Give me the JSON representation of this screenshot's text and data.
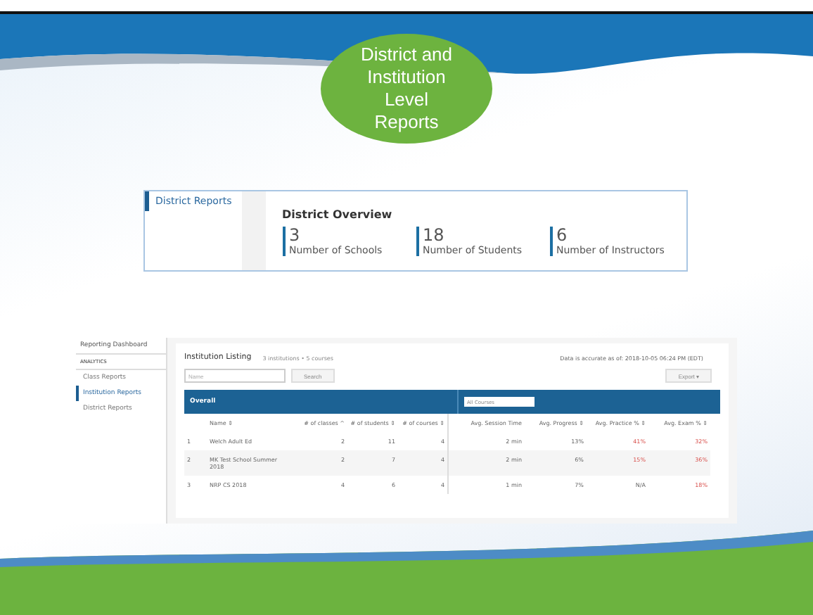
{
  "slide": {
    "title": "District and Institution Level Reports"
  },
  "district_panel": {
    "sidebar": [
      {
        "label": "District Reports",
        "selected": true
      }
    ],
    "title": "District Overview",
    "stats": [
      {
        "value": "3",
        "label": "Number of Schools"
      },
      {
        "value": "18",
        "label": "Number of Students"
      },
      {
        "value": "6",
        "label": "Number of Instructors"
      }
    ]
  },
  "institution_panel": {
    "sidebar": {
      "title": "Reporting Dashboard",
      "section": "ANALYTICS",
      "items": [
        {
          "label": "Class Reports",
          "selected": false
        },
        {
          "label": "Institution Reports",
          "selected": true
        },
        {
          "label": "District Reports",
          "selected": false
        }
      ]
    },
    "title": "Institution Listing",
    "summary": "3 institutions • 5 courses",
    "accuracy": "Data is accurate as of: 2018-10-05 06:24 PM (EDT)",
    "search": {
      "placeholder": "Name",
      "button": "Search"
    },
    "export": "Export ▾",
    "band": {
      "label": "Overall",
      "select": "All Courses"
    },
    "columns": [
      "Name ⇕",
      "# of classes ^",
      "# of students ⇕",
      "# of courses ⇕",
      "Avg. Session Time",
      "Avg. Progress ⇕",
      "Avg. Practice % ⇕",
      "Avg. Exam % ⇕"
    ],
    "rows": [
      {
        "number": "1",
        "cells": [
          {
            "text": "Welch Adult Ed",
            "alert": false
          },
          {
            "text": "2",
            "alert": false
          },
          {
            "text": "11",
            "alert": false
          },
          {
            "text": "4",
            "alert": false
          },
          {
            "text": "2 min",
            "alert": false
          },
          {
            "text": "13%",
            "alert": false
          },
          {
            "text": "41%",
            "alert": true
          },
          {
            "text": "32%",
            "alert": true
          }
        ]
      },
      {
        "number": "2",
        "cells": [
          {
            "text": "MK Test School Summer 2018",
            "alert": false
          },
          {
            "text": "2",
            "alert": false
          },
          {
            "text": "7",
            "alert": false
          },
          {
            "text": "4",
            "alert": false
          },
          {
            "text": "2 min",
            "alert": false
          },
          {
            "text": "6%",
            "alert": false
          },
          {
            "text": "15%",
            "alert": true
          },
          {
            "text": "36%",
            "alert": true
          }
        ]
      },
      {
        "number": "3",
        "cells": [
          {
            "text": "NRP CS 2018",
            "alert": false
          },
          {
            "text": "4",
            "alert": false
          },
          {
            "text": "6",
            "alert": false
          },
          {
            "text": "4",
            "alert": false
          },
          {
            "text": "1 min",
            "alert": false
          },
          {
            "text": "7%",
            "alert": false
          },
          {
            "text": "N/A",
            "alert": false
          },
          {
            "text": "18%",
            "alert": true
          }
        ]
      }
    ]
  }
}
